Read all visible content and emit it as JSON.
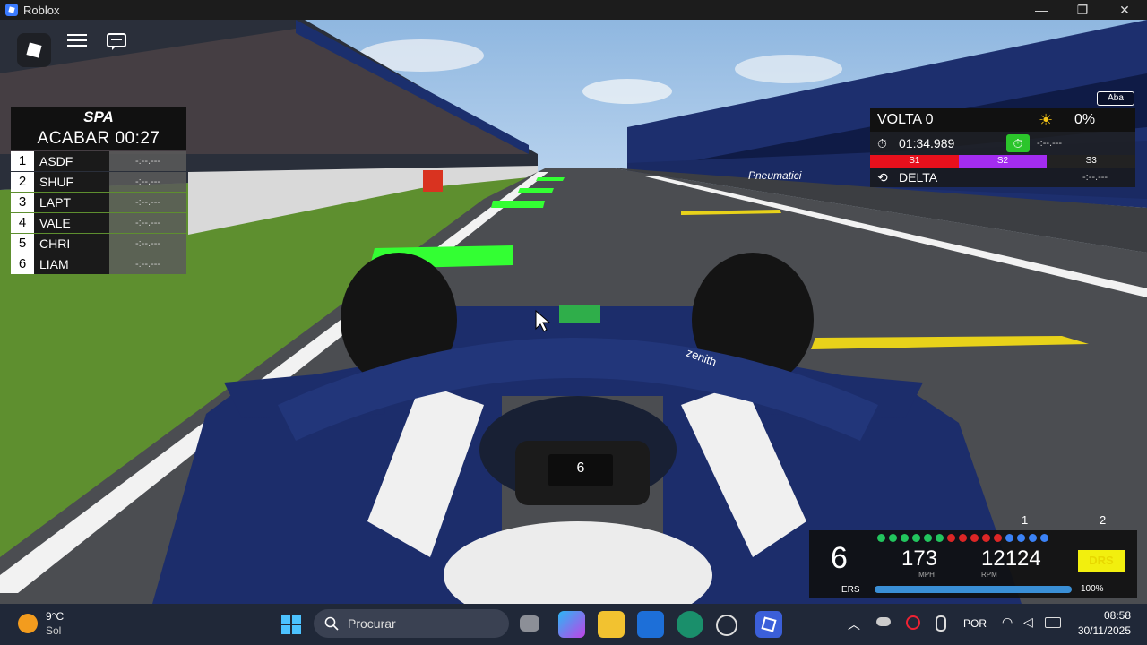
{
  "window": {
    "title": "Roblox",
    "minimize_label": "—",
    "maximize_label": "❐",
    "close_label": "✕"
  },
  "hud": {
    "leaderboard": {
      "logo": "SPA",
      "countdown_label": "ACABAR",
      "countdown": "00:27",
      "rows": [
        {
          "pos": "1",
          "name": "ASDF",
          "time": "-:--.---"
        },
        {
          "pos": "2",
          "name": "SHUF",
          "time": "-:--.---"
        },
        {
          "pos": "3",
          "name": "LAPT",
          "time": "-:--.---"
        },
        {
          "pos": "4",
          "name": "VALE",
          "time": "-:--.---"
        },
        {
          "pos": "5",
          "name": "CHRI",
          "time": "-:--.---"
        },
        {
          "pos": "6",
          "name": "LIAM",
          "time": "-:--.---"
        }
      ]
    },
    "lap_panel": {
      "tab_hint": "Aba",
      "lap_label": "VOLTA 0",
      "weather_value": "0%",
      "current_time": "01:34.989",
      "best_time": "-:--.---",
      "sectors": [
        "S1",
        "S2",
        "S3"
      ],
      "delta_label": "DELTA",
      "delta_value": "-:--.---"
    },
    "dashboard": {
      "gear": "6",
      "speed": "173",
      "speed_unit": "MPH",
      "rpm": "12124",
      "rpm_unit": "RPM",
      "drs_label": "DRS",
      "ers_label": "ERS",
      "ers_percent": "100%",
      "ers_level": 1.0,
      "marker_1": "1",
      "marker_2": "2"
    },
    "steering_display_gear": "6",
    "car_sponsor": "zenith"
  },
  "track": {
    "banner_text": "Pneumatici"
  },
  "taskbar": {
    "weather_temp": "9°C",
    "weather_desc": "Sol",
    "search_placeholder": "Procurar",
    "language": "POR",
    "time": "08:58",
    "date": "30/11/2025"
  },
  "colors": {
    "s1": "#e8101c",
    "s2": "#a32cf0",
    "s3": "#222222",
    "drs": "#f2ef0e",
    "green_marker": "#33ff33",
    "car_blue": "#1c2d6b"
  }
}
